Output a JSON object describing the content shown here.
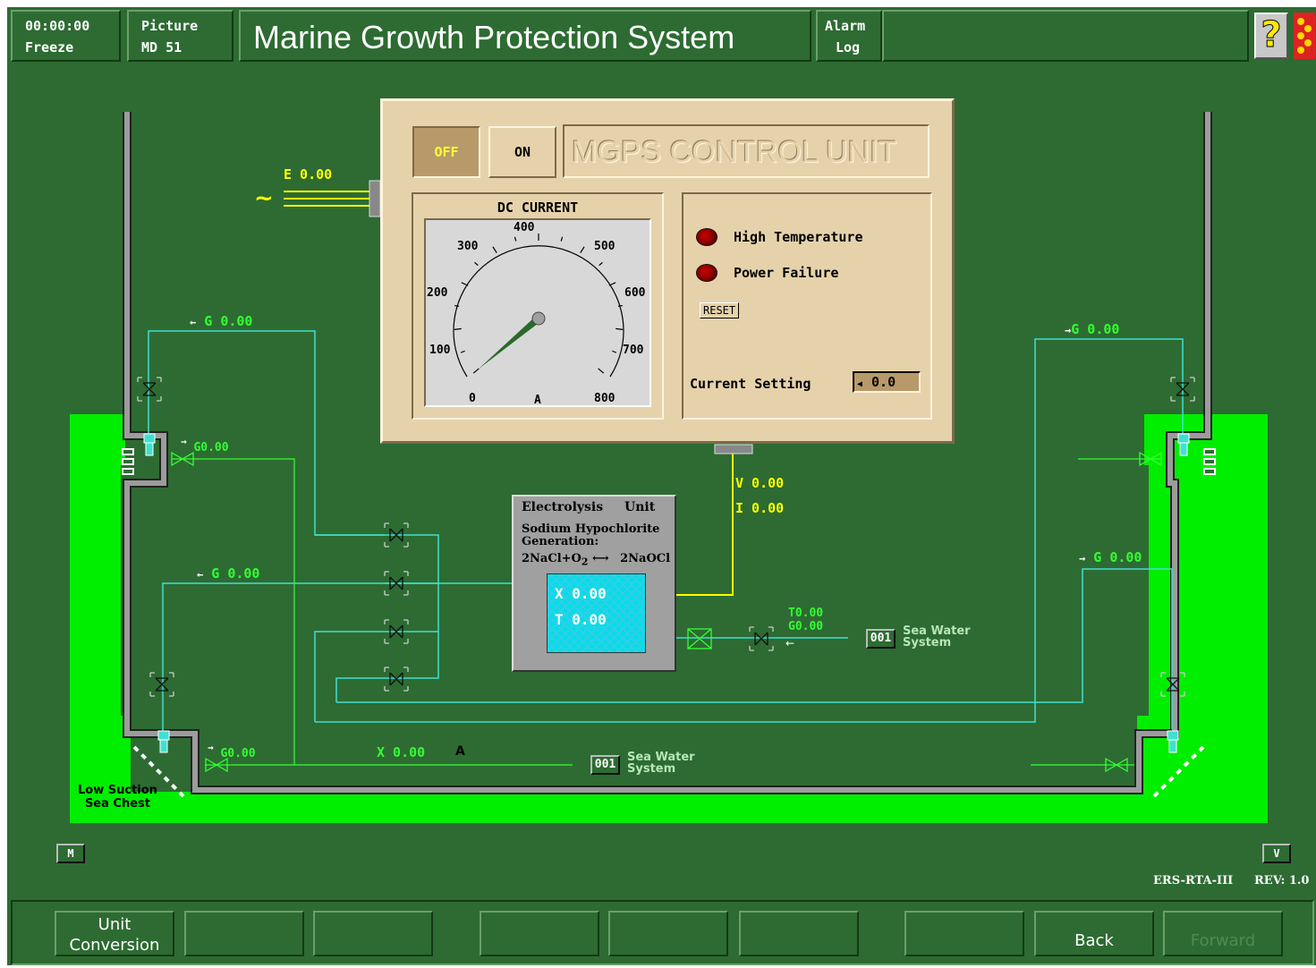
{
  "header": {
    "time": "00:00:00",
    "freeze": "Freeze",
    "picture_label": "Picture",
    "picture_id": "MD 51",
    "title": "Marine Growth Protection System",
    "alarm": "Alarm",
    "log": "Log",
    "help_icon": "question-mark-icon",
    "logo_icon": "emblem-icon"
  },
  "control_unit": {
    "off_label": "OFF",
    "on_label": "ON",
    "title": "MGPS CONTROL UNIT",
    "gauge": {
      "title": "DC CURRENT",
      "ticks": [
        "0",
        "100",
        "200",
        "300",
        "400",
        "500",
        "600",
        "700",
        "800"
      ],
      "unit": "A",
      "value": 0
    },
    "alarms": [
      {
        "label": "High Temperature",
        "color": "#8b0000"
      },
      {
        "label": "Power Failure",
        "color": "#8b0000"
      }
    ],
    "reset_label": "RESET",
    "current_setting_label": "Current Setting",
    "current_setting_value": "0.0"
  },
  "supply": {
    "e_value": "E 0.00"
  },
  "electrolysis": {
    "title": "Electrolysis",
    "title2": "Unit",
    "line1": "Sodium  Hypochlorite",
    "line2": "Generation:",
    "formula_left": "2NaCl+O",
    "formula_sub": "2",
    "formula_arrow": "⟷",
    "formula_right": "2NaOCl",
    "x_value": "X 0.00",
    "t_value": "T 0.00"
  },
  "readouts": {
    "v": "V 0.00",
    "i": "I 0.00",
    "left_top_g": "G 0.00",
    "left_top_arrow": "←",
    "left_sea_g": "G0.00",
    "left_sea_arrow": "→",
    "left_mid_g": "G 0.00",
    "left_mid_arrow": "←",
    "left_bottom_g": "G0.00",
    "left_bottom_arrow": "→",
    "bottom_x": "X 0.00",
    "bottom_unit": "A",
    "right_top_g": "G 0.00",
    "right_top_arrow": "→",
    "right_mid_g": "G 0.00",
    "right_mid_arrow": "→",
    "feed_t": "T0.00",
    "feed_g": "G0.00",
    "feed_arrow": "←"
  },
  "sea_water": [
    {
      "tag": "001",
      "line1": "Sea Water",
      "line2": "System"
    },
    {
      "tag": "001",
      "line1": "Sea Water",
      "line2": "System"
    }
  ],
  "sea_chest": {
    "line1": "Low Suction",
    "line2": "Sea Chest"
  },
  "m_button": "M",
  "v_button": "V",
  "footer": {
    "system": "ERS-RTA-III",
    "rev": "REV: 1.0"
  },
  "bottom_buttons": [
    "Unit\nConversion",
    "",
    "",
    "",
    "",
    "",
    "",
    "Back",
    "Forward"
  ],
  "colors": {
    "background": "#2d6b32",
    "water": "#00ee00",
    "pipe": "#40e0d0",
    "cable": "#ffff00",
    "panel": "#e6d2aa"
  }
}
